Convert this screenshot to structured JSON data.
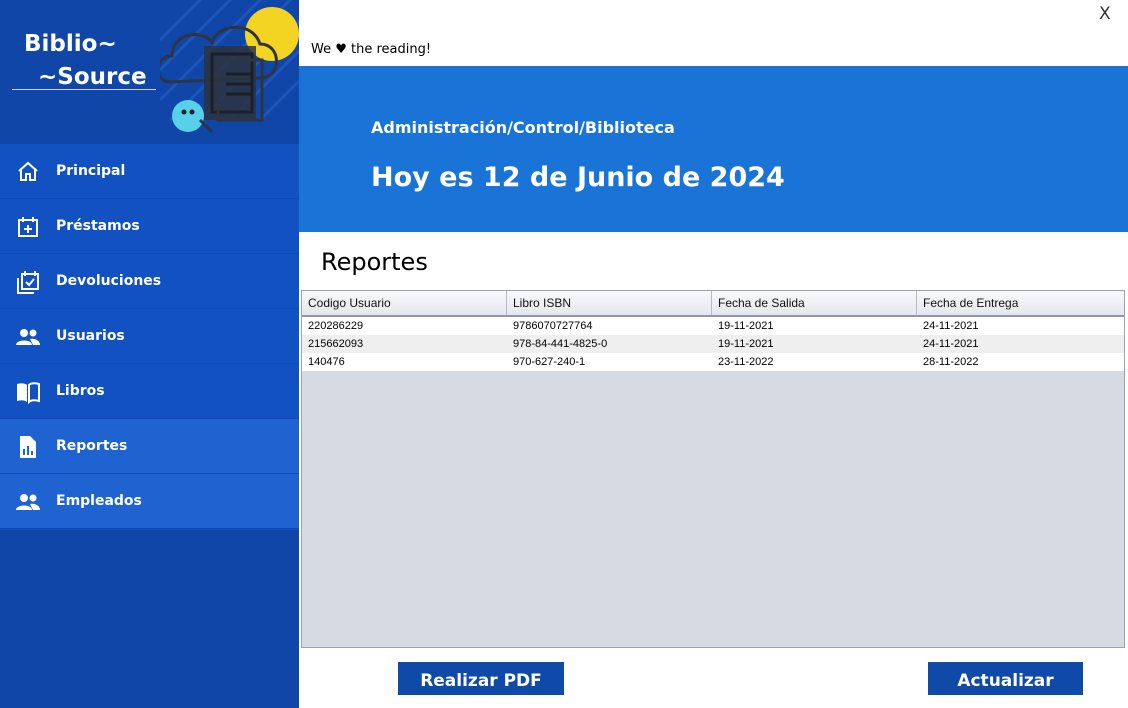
{
  "app": {
    "logo_line1": "Biblio~",
    "logo_line2": "~Source",
    "close_label": "X",
    "tagline": "We ♥  the reading!"
  },
  "sidebar": {
    "items": [
      {
        "label": "Principal",
        "icon": "home-icon"
      },
      {
        "label": "Préstamos",
        "icon": "calendar-plus-icon"
      },
      {
        "label": "Devoluciones",
        "icon": "calendar-check-icon"
      },
      {
        "label": "Usuarios",
        "icon": "users-icon"
      },
      {
        "label": "Libros",
        "icon": "book-open-icon"
      },
      {
        "label": "Reportes",
        "icon": "report-icon",
        "active": true
      },
      {
        "label": "Empleados",
        "icon": "users-icon"
      }
    ]
  },
  "header": {
    "breadcrumb": "Administración/Control/Biblioteca",
    "date_title": "Hoy es 12 de Junio de 2024"
  },
  "main": {
    "title": "Reportes",
    "table": {
      "columns": [
        "Codigo Usuario",
        "Libro ISBN",
        "Fecha de Salida",
        "Fecha de Entrega"
      ],
      "rows": [
        [
          "220286229",
          "9786070727764",
          "19-11-2021",
          "24-11-2021"
        ],
        [
          "215662093",
          "978-84-441-4825-0",
          "19-11-2021",
          "24-11-2021"
        ],
        [
          "140476",
          "970-627-240-1",
          "23-11-2022",
          "28-11-2022"
        ]
      ]
    },
    "buttons": {
      "pdf": "Realizar PDF",
      "refresh": "Actualizar"
    }
  },
  "colors": {
    "sidebar": "#1151c2",
    "sidebar_active": "#1e63cf",
    "banner": "#1a73d6",
    "button": "#0f4aa8"
  }
}
